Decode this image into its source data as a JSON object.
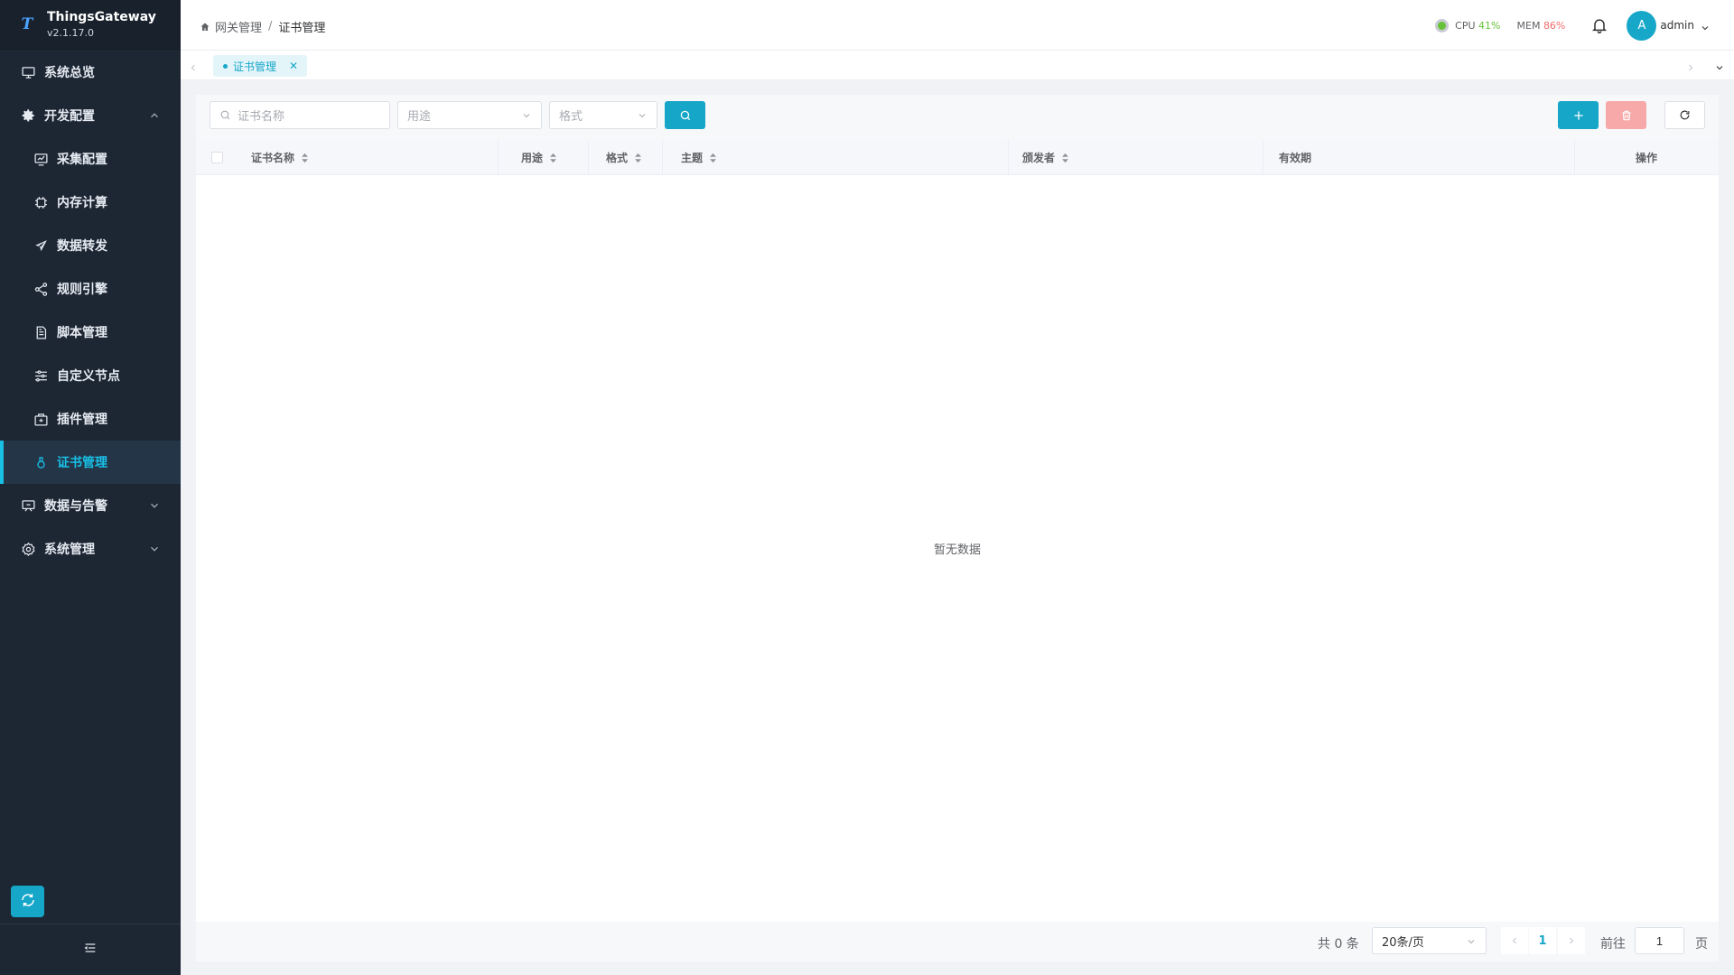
{
  "app": {
    "name": "ThingsGateway",
    "version": "v2.1.17.0"
  },
  "sidebar": {
    "items": [
      {
        "label": "系统总览",
        "icon": "dashboard-icon",
        "level": "top",
        "active": false
      },
      {
        "label": "开发配置",
        "icon": "gear-icon",
        "level": "top",
        "expanded": true
      },
      {
        "label": "采集配置",
        "icon": "chart-icon",
        "level": "sub"
      },
      {
        "label": "内存计算",
        "icon": "chip-icon",
        "level": "sub"
      },
      {
        "label": "数据转发",
        "icon": "send-icon",
        "level": "sub"
      },
      {
        "label": "规则引擎",
        "icon": "share-icon",
        "level": "sub"
      },
      {
        "label": "脚本管理",
        "icon": "document-icon",
        "level": "sub"
      },
      {
        "label": "自定义节点",
        "icon": "sliders-icon",
        "level": "sub"
      },
      {
        "label": "插件管理",
        "icon": "package-icon",
        "level": "sub"
      },
      {
        "label": "证书管理",
        "icon": "certificate-icon",
        "level": "sub",
        "active": true
      },
      {
        "label": "数据与告警",
        "icon": "monitor-icon",
        "level": "top",
        "expanded": false
      },
      {
        "label": "系统管理",
        "icon": "settings-icon",
        "level": "top",
        "expanded": false
      }
    ]
  },
  "header": {
    "breadcrumb": [
      "网关管理",
      "证书管理"
    ],
    "cpu_label": "CPU",
    "cpu_value": "41%",
    "mem_label": "MEM",
    "mem_value": "86%",
    "user": "admin",
    "avatar_letter": "A",
    "colors": {
      "cpu": "#67c23a",
      "mem": "#f56c6c"
    }
  },
  "tabs": [
    {
      "label": "证书管理",
      "active": true
    }
  ],
  "toolbar": {
    "search_placeholder": "证书名称",
    "use_placeholder": "用途",
    "format_placeholder": "格式"
  },
  "table": {
    "columns": [
      "证书名称",
      "用途",
      "格式",
      "主题",
      "颁发者",
      "有效期",
      "操作"
    ],
    "rows": [],
    "empty_text": "暂无数据"
  },
  "pagination": {
    "total_text": "共 0 条",
    "page_size": "20条/页",
    "current_page": "1",
    "goto_label": "前往",
    "goto_value": "1",
    "page_suffix": "页"
  },
  "accent_color": "#16a6c8"
}
